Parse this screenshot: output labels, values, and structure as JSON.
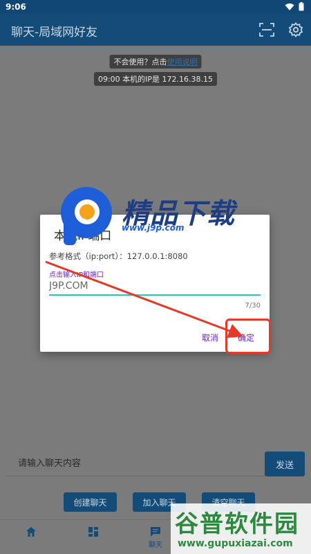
{
  "status_bar": {
    "time": "9:06"
  },
  "app_bar": {
    "title": "聊天-局域网好友",
    "scan_icon": "scan-icon",
    "settings_icon": "gear-icon"
  },
  "banner": {
    "help_text": "不会使用？点击",
    "help_link": "使用说明",
    "ip_text": "09:00 本机的IP是 172.16.38.15"
  },
  "dialog": {
    "title": "本机IP端口",
    "hint": "参考格式（ip:port）：127.0.0.1:8080",
    "field_label": "点击输入IP和端口",
    "field_value": "J9P.COM",
    "counter": "7/30",
    "cancel_label": "取消",
    "confirm_label": "确定"
  },
  "composer": {
    "placeholder": "请输入聊天内容",
    "send_label": "发送"
  },
  "actions": {
    "create": "创建聊天",
    "join": "加入聊天",
    "clear": "清空聊天"
  },
  "bottom_nav": {
    "chat_label": "聊天"
  },
  "overlays": {
    "logo_text": "精品下载",
    "logo_url": "www.j9p.com",
    "watermark_title": "谷普软件园",
    "watermark_url": "www.gupuxiazai.com"
  },
  "colors": {
    "primary": "#134b79",
    "accent": "#6a1ee0",
    "underline": "#1ec9c0",
    "annotation": "#e43a2a"
  }
}
